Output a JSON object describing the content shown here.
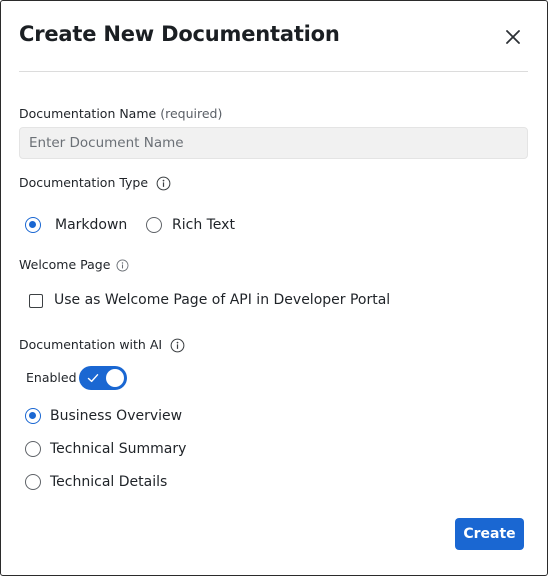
{
  "dialog": {
    "title": "Create New Documentation",
    "close_icon": "close-icon"
  },
  "name_field": {
    "label": "Documentation Name",
    "required_note": "(required)",
    "placeholder": "Enter Document Name",
    "value": ""
  },
  "doc_type": {
    "label": "Documentation Type",
    "info_icon": "info-icon",
    "options": [
      {
        "label": "Markdown",
        "selected": true
      },
      {
        "label": "Rich Text",
        "selected": false
      }
    ]
  },
  "welcome_page": {
    "label": "Welcome Page",
    "info_icon": "info-icon",
    "checkbox_label": "Use as Welcome Page of API in Developer Portal",
    "checked": false
  },
  "ai": {
    "label": "Documentation with AI",
    "info_icon": "info-icon",
    "toggle_label": "Enabled",
    "enabled": true,
    "options": [
      {
        "label": "Business Overview",
        "selected": true
      },
      {
        "label": "Technical Summary",
        "selected": false
      },
      {
        "label": "Technical Details",
        "selected": false
      }
    ]
  },
  "footer": {
    "create_label": "Create"
  },
  "colors": {
    "accent": "#1a67d2",
    "input_background": "#f1f1f1",
    "divider": "#dcdcdc"
  }
}
